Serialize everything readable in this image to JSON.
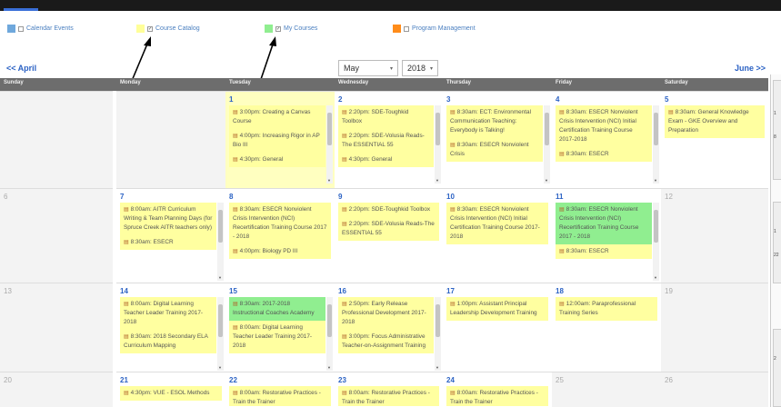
{
  "legend": [
    {
      "label": "Calendar Events",
      "color": "#6fa8dc",
      "checked": false
    },
    {
      "label": "Course Catalog",
      "color": "#ffff99",
      "checked": true
    },
    {
      "label": "My Courses",
      "color": "#90ee90",
      "checked": true
    },
    {
      "label": "Program Management",
      "color": "#ff8c1a",
      "checked": false
    }
  ],
  "nav": {
    "prev": "<< April",
    "next": "June >>",
    "month": "May",
    "year": "2018"
  },
  "days": [
    "Sunday",
    "Monday",
    "Tuesday",
    "Wednesday",
    "Thursday",
    "Friday",
    "Saturday"
  ],
  "weeks": [
    [
      {
        "num": "",
        "out": true,
        "events": []
      },
      {
        "num": "",
        "out": true,
        "events": []
      },
      {
        "num": "1",
        "today": true,
        "scroll": true,
        "events": [
          {
            "text": "3:00pm: Creating a Canvas Course"
          },
          {
            "text": "4:00pm: Increasing Rigor in AP Bio III"
          },
          {
            "text": "4:30pm: General"
          }
        ]
      },
      {
        "num": "2",
        "scroll": true,
        "events": [
          {
            "text": "2:20pm: SDE-Toughkid Toolbox"
          },
          {
            "text": "2:20pm: SDE-Volusia Reads-The ESSENTIAL 55"
          },
          {
            "text": "4:30pm: General"
          }
        ]
      },
      {
        "num": "3",
        "scroll": true,
        "events": [
          {
            "text": "8:30am: ECT: Environmental Communication Teaching: Everybody is Talking!"
          },
          {
            "text": "8:30am: ESECR Nonviolent Crisis"
          }
        ]
      },
      {
        "num": "4",
        "scroll": true,
        "events": [
          {
            "text": "8:30am: ESECR Nonviolent Crisis Intervention (NCI) Initial Certification Training Course 2017-2018"
          },
          {
            "text": "8:30am: ESECR"
          }
        ]
      },
      {
        "num": "5",
        "events": [
          {
            "text": "8:30am: General Knowledge Exam - GKE Overview and Preparation"
          }
        ]
      }
    ],
    [
      {
        "num": "6",
        "out": true,
        "events": []
      },
      {
        "num": "7",
        "scroll": true,
        "events": [
          {
            "text": "8:00am: AITR Curriculum Writing & Team Planning Days (for Spruce Creek AITR teachers only)"
          },
          {
            "text": "8:30am: ESECR"
          }
        ]
      },
      {
        "num": "8",
        "events": [
          {
            "text": "8:30am: ESECR Nonviolent Crisis Intervention (NCI) Recertification Training Course 2017 - 2018"
          },
          {
            "text": "4:00pm: Biology PD III"
          }
        ]
      },
      {
        "num": "9",
        "events": [
          {
            "text": "2:20pm: SDE-Toughkid Toolbox"
          },
          {
            "text": "2:20pm: SDE-Volusia Reads-The ESSENTIAL 55"
          }
        ]
      },
      {
        "num": "10",
        "events": [
          {
            "text": "8:30am: ESECR Nonviolent Crisis Intervention (NCI) Initial Certification Training Course 2017-2018"
          }
        ]
      },
      {
        "num": "11",
        "scroll": true,
        "events": [
          {
            "text": "8:30am: ESECR Nonviolent Crisis Intervention (NCI) Recertification Training Course 2017 - 2018",
            "green": true
          },
          {
            "text": "8:30am: ESECR"
          }
        ]
      },
      {
        "num": "12",
        "out": true,
        "events": []
      }
    ],
    [
      {
        "num": "13",
        "out": true,
        "events": []
      },
      {
        "num": "14",
        "scroll": true,
        "events": [
          {
            "text": "8:00am: Digital Learning Teacher Leader Training 2017-2018"
          },
          {
            "text": "8:30am: 2018 Secondary ELA Curriculum Mapping"
          }
        ]
      },
      {
        "num": "15",
        "scroll": true,
        "events": [
          {
            "text": "8:30am: 2017-2018 Instructional Coaches Academy",
            "green": true
          },
          {
            "text": "8:00am: Digital Learning Teacher Leader Training 2017-2018"
          }
        ]
      },
      {
        "num": "16",
        "scroll": true,
        "events": [
          {
            "text": "2:50pm: Early Release Professional Development 2017-2018"
          },
          {
            "text": "3:00pm: Focus Administrative Teacher-on-Assignment Training"
          }
        ]
      },
      {
        "num": "17",
        "events": [
          {
            "text": "1:00pm: Assistant Principal Leadership Development Training"
          }
        ]
      },
      {
        "num": "18",
        "events": [
          {
            "text": "12:00am: Paraprofessional Training Series"
          }
        ]
      },
      {
        "num": "19",
        "out": true,
        "events": []
      }
    ],
    [
      {
        "num": "20",
        "out": true,
        "events": []
      },
      {
        "num": "21",
        "events": [
          {
            "text": "4:30pm: VUE - ESOL Methods"
          }
        ]
      },
      {
        "num": "22",
        "events": [
          {
            "text": "8:00am: Restorative Practices - Train the Trainer"
          }
        ]
      },
      {
        "num": "23",
        "events": [
          {
            "text": "8:00am: Restorative Practices - Train the Trainer"
          }
        ]
      },
      {
        "num": "24",
        "events": [
          {
            "text": "8:00am: Restorative Practices - Train the Trainer"
          }
        ]
      },
      {
        "num": "25",
        "out": true,
        "events": []
      },
      {
        "num": "26",
        "out": true,
        "events": []
      }
    ]
  ],
  "sidebar_text": [
    "1",
    "8",
    "1",
    "22",
    "2"
  ]
}
